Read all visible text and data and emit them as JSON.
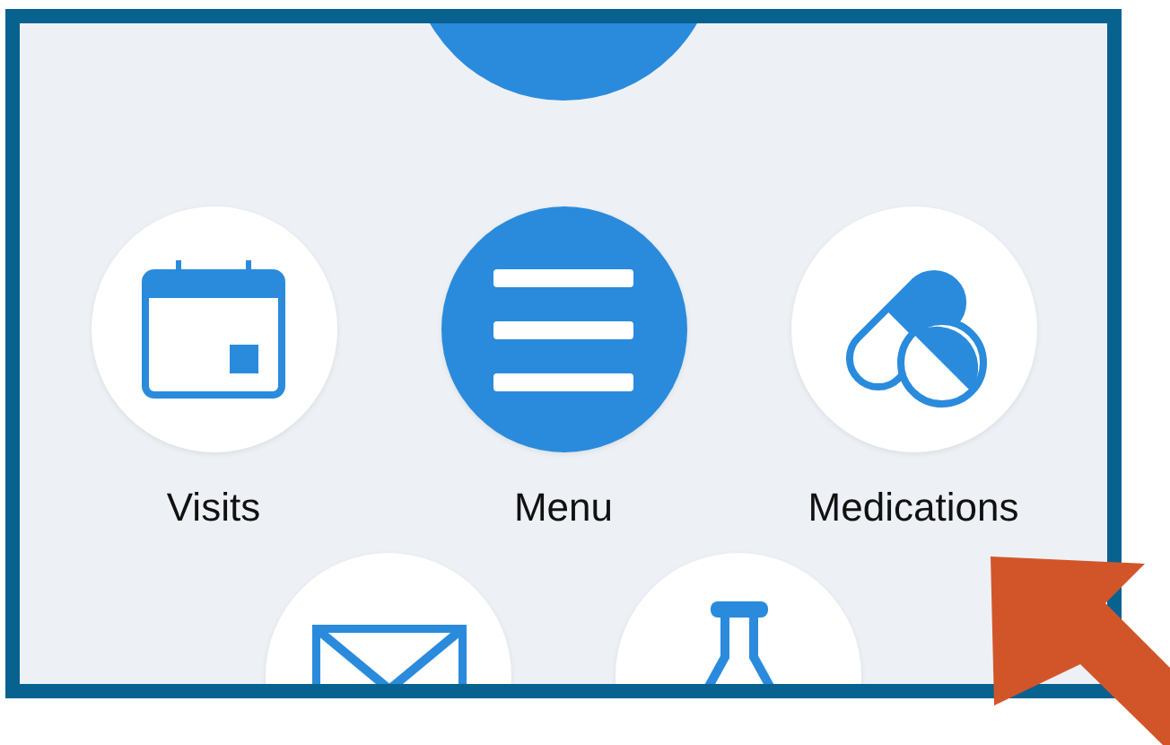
{
  "main_items": [
    {
      "label": "Visits",
      "kind": "calendar",
      "filled": false
    },
    {
      "label": "Menu",
      "kind": "menu",
      "filled": true
    },
    {
      "label": "Medications",
      "kind": "pills",
      "filled": false
    }
  ],
  "lower_items": [
    {
      "kind": "envelope",
      "filled": false
    },
    {
      "kind": "flask",
      "filled": false
    }
  ]
}
